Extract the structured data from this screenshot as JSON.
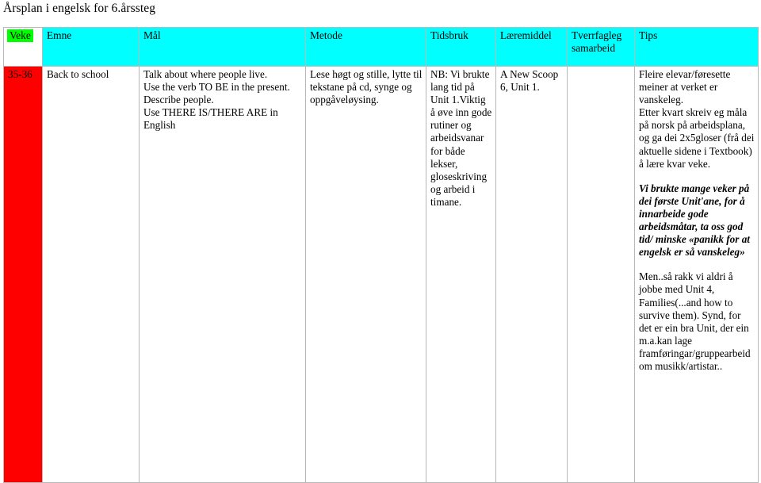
{
  "document": {
    "title": "Årsplan i engelsk for 6.årssteg"
  },
  "table": {
    "headers": {
      "veke": "Veke",
      "emne": "Emne",
      "mal": "Mål",
      "metode": "Metode",
      "tidsbruk": "Tidsbruk",
      "laeremiddel": "Læremiddel",
      "tverrfagleg": "Tverrfagleg samarbeid",
      "tips": "Tips"
    },
    "colors": {
      "header_background": "#00ffff",
      "veke_highlight": "#00ff00",
      "veke_cell_background": "#ff0000",
      "border": "#b8b8b8"
    },
    "rows": [
      {
        "veke": "35-36",
        "emne": "Back to school",
        "mal": [
          "Talk about where people live.",
          "Use the verb TO BE in the present.",
          "Describe people.",
          "Use THERE IS/THERE ARE in English"
        ],
        "metode": [
          "Lese høgt og stille, lytte til tekstane på cd, synge og oppgåveløysing."
        ],
        "tidsbruk": [
          "NB: Vi brukte lang tid på Unit 1.Viktig å øve inn gode rutiner og arbeidsvanar for både lekser, gloseskriving og arbeid i timane."
        ],
        "laeremiddel": [
          "A New Scoop 6, Unit 1."
        ],
        "tverrfagleg": [],
        "tips": {
          "para1": "Fleire elevar/føresette meiner at verket er vanskeleg.",
          "para2": "Etter kvart skreiv eg måla på norsk på arbeidsplana, og ga dei 2x5gloser (frå dei aktuelle sidene i Textbook) å lære kvar veke.",
          "para3_bold_italic": "Vi brukte mange veker på dei første Unit'ane, for å innarbeide gode arbeidsmåtar, ta oss god tid/ minske «panikk for at engelsk er så vanskeleg»",
          "para4": "Men..så rakk vi aldri å jobbe med Unit 4, Families(...and how to survive them). Synd, for det er ein bra Unit, der ein m.a.kan lage framføringar/gruppearbeid om musikk/artistar.."
        }
      }
    ]
  }
}
